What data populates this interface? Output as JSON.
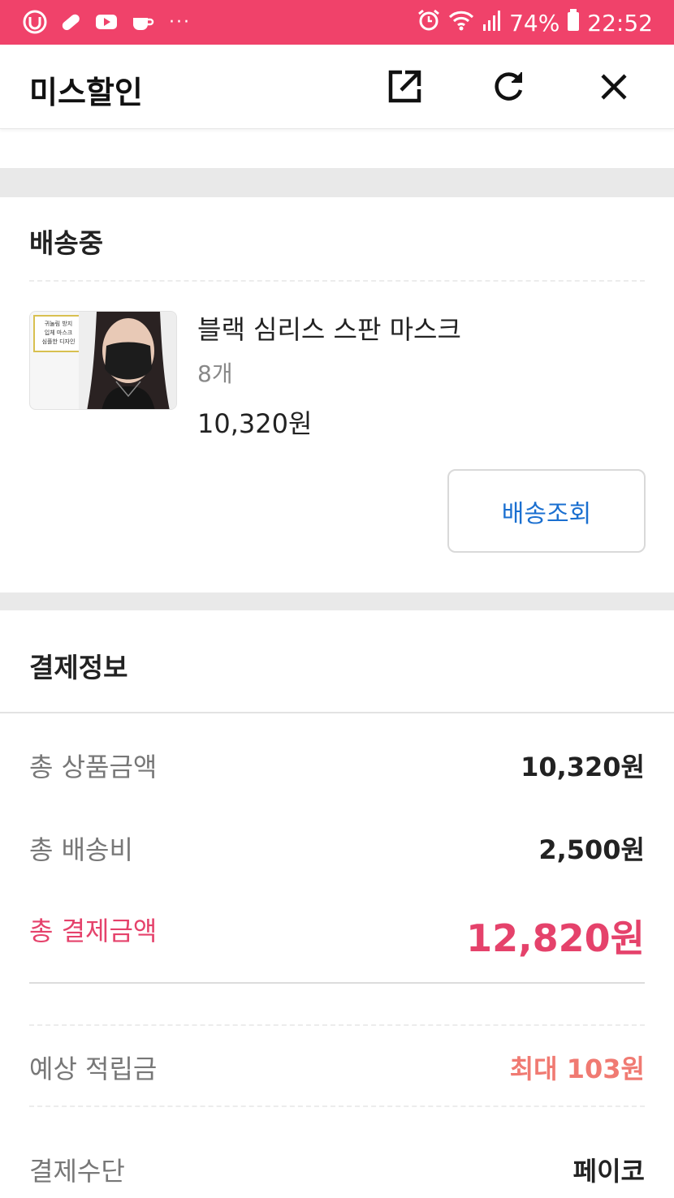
{
  "status_bar": {
    "battery": "74%",
    "time": "22:52",
    "dots": "···"
  },
  "header": {
    "title": "미스할인"
  },
  "shipping": {
    "section_title": "배송중",
    "product": {
      "thumb_lines": [
        "귀눌림 방지",
        "입체 마스크",
        "심플한 디자인"
      ],
      "name": "블랙 심리스 스판 마스크",
      "quantity": "8개",
      "price": "10,320원"
    },
    "track_button": "배송조회"
  },
  "payment": {
    "section_title": "결제정보",
    "rows": [
      {
        "label": "총 상품금액",
        "value": "10,320원"
      },
      {
        "label": "총 배송비",
        "value": "2,500원"
      },
      {
        "label": "총 결제금액",
        "value": "12,820원"
      },
      {
        "label": "예상 적립금",
        "value": "최대 103원"
      },
      {
        "label": "결제수단",
        "value": "페이코"
      }
    ]
  },
  "colors": {
    "status_bar": "#f0426a",
    "accent_pink": "#e5426b",
    "link_blue": "#1a6fd0",
    "points": "#f07a72"
  }
}
